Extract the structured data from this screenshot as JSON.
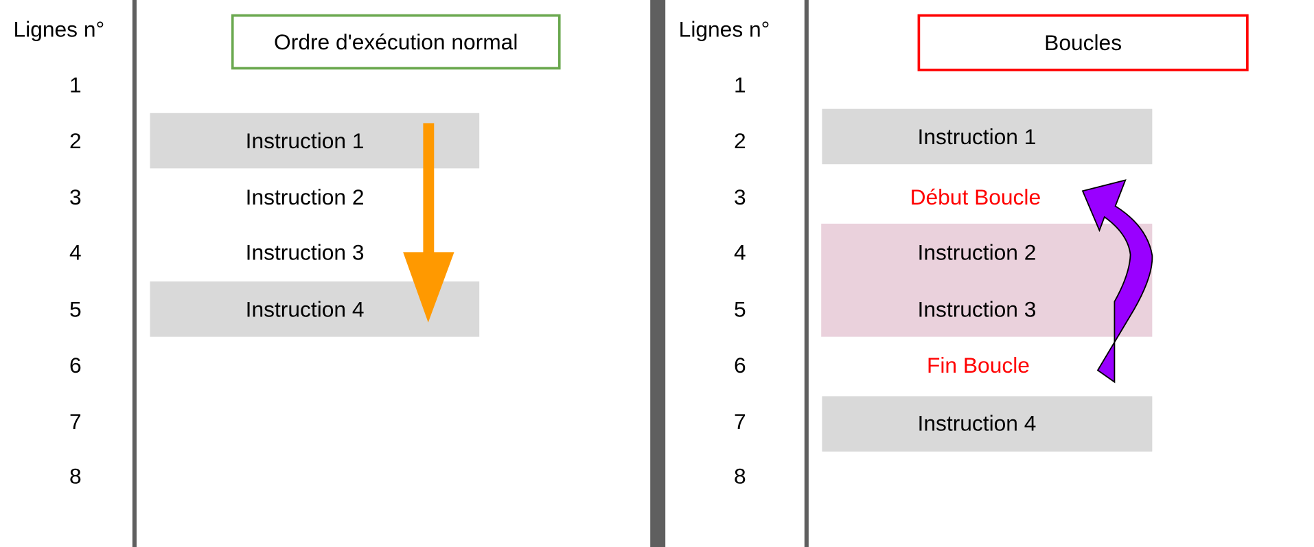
{
  "left_panel": {
    "header": "Lignes n°",
    "line_numbers": [
      "1",
      "2",
      "3",
      "4",
      "5",
      "6",
      "7",
      "8"
    ],
    "title": "Ordre d'exécution normal",
    "title_border_color": "#6aa84f",
    "instructions": [
      "Instruction 1",
      "Instruction 2",
      "Instruction 3",
      "Instruction 4"
    ],
    "arrow_color": "#ff9900",
    "arrow_icon": "down-arrow-icon"
  },
  "right_panel": {
    "header": "Lignes n°",
    "line_numbers": [
      "1",
      "2",
      "3",
      "4",
      "5",
      "6",
      "7",
      "8"
    ],
    "title": "Boucles",
    "title_border_color": "#ff0000",
    "instruction_1": "Instruction 1",
    "loop_start": "Début Boucle",
    "instruction_2": "Instruction 2",
    "instruction_3": "Instruction 3",
    "loop_end": "Fin Boucle",
    "instruction_4": "Instruction 4",
    "loop_text_color": "#ff0000",
    "loop_fill_color": "#ead1dc",
    "arrow_color": "#9900ff",
    "arrow_icon": "curved-up-arrow-icon"
  },
  "colors": {
    "row_fill": "#d9d9d9",
    "divider": "#5f5f5f"
  }
}
